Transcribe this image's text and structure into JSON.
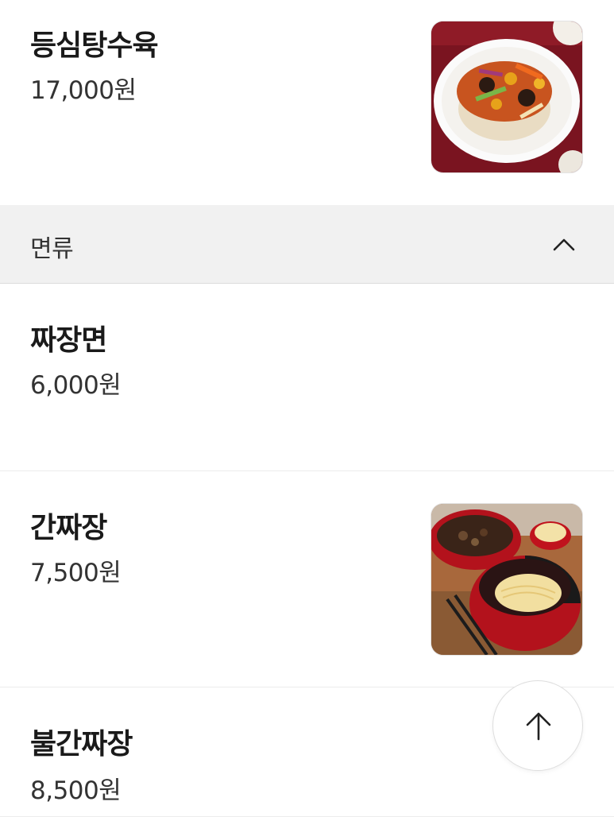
{
  "items": [
    {
      "name": "등심탕수육",
      "price": "17,000원",
      "image": "sweet-sour-pork-photo"
    },
    {
      "name": "짜장면",
      "price": "6,000원"
    },
    {
      "name": "간짜장",
      "price": "7,500원",
      "image": "ganjjajang-noodles-photo"
    },
    {
      "name": "불간짜장",
      "price": "8,500원"
    }
  ],
  "category": {
    "label": "면류",
    "icon": "chevron-up-icon",
    "expanded": true
  },
  "scroll_top": {
    "icon": "arrow-up-icon"
  }
}
